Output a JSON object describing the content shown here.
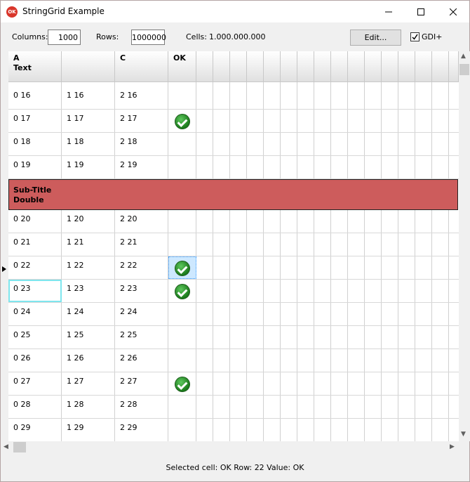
{
  "window": {
    "title": "StringGrid Example",
    "app_icon": "OK"
  },
  "toolbar": {
    "columns_label": "Columns:",
    "columns_value": "1000",
    "rows_label": "Rows:",
    "rows_value": "1000000",
    "cells_label": "Cells:",
    "cells_value": "1.000.000.000",
    "edit_label": "Edit...",
    "gdi_label": "GDI+",
    "gdi_checked": true
  },
  "grid": {
    "headers": [
      "A\nText",
      "",
      "C",
      "OK"
    ],
    "subtitle": "Sub-Title\nDouble",
    "rows_before": [
      {
        "cells": [
          "0 16",
          "1 16",
          "2 16"
        ],
        "ok": false
      },
      {
        "cells": [
          "0 17",
          "1 17",
          "2 17"
        ],
        "ok": true
      },
      {
        "cells": [
          "0 18",
          "1 18",
          "2 18"
        ],
        "ok": false
      },
      {
        "cells": [
          "0 19",
          "1 19",
          "2 19"
        ],
        "ok": false
      }
    ],
    "rows_after": [
      {
        "cells": [
          "0 20",
          "1 20",
          "2 20"
        ],
        "ok": false
      },
      {
        "cells": [
          "0 21",
          "1 21",
          "2 21"
        ],
        "ok": false
      },
      {
        "cells": [
          "0 22",
          "1 22",
          "2 22"
        ],
        "ok": true
      },
      {
        "cells": [
          "0 23",
          "1 23",
          "2 23"
        ],
        "ok": true
      },
      {
        "cells": [
          "0 24",
          "1 24",
          "2 24"
        ],
        "ok": false
      },
      {
        "cells": [
          "0 25",
          "1 25",
          "2 25"
        ],
        "ok": false
      },
      {
        "cells": [
          "0 26",
          "1 26",
          "2 26"
        ],
        "ok": false
      },
      {
        "cells": [
          "0 27",
          "1 27",
          "2 27"
        ],
        "ok": true
      },
      {
        "cells": [
          "0 28",
          "1 28",
          "2 28"
        ],
        "ok": false
      },
      {
        "cells": [
          "0 29",
          "1 29",
          "2 29"
        ],
        "ok": false
      }
    ],
    "selected_row": "0 22",
    "focused_cell": "0 23"
  },
  "status": "Selected cell: OK Row: 22 Value: OK",
  "colors": {
    "subtitle_bg": "#cd5c5c",
    "check_green": "#2e8b2e",
    "focus": "#7fe6ee",
    "selection": "#cde8ff"
  }
}
